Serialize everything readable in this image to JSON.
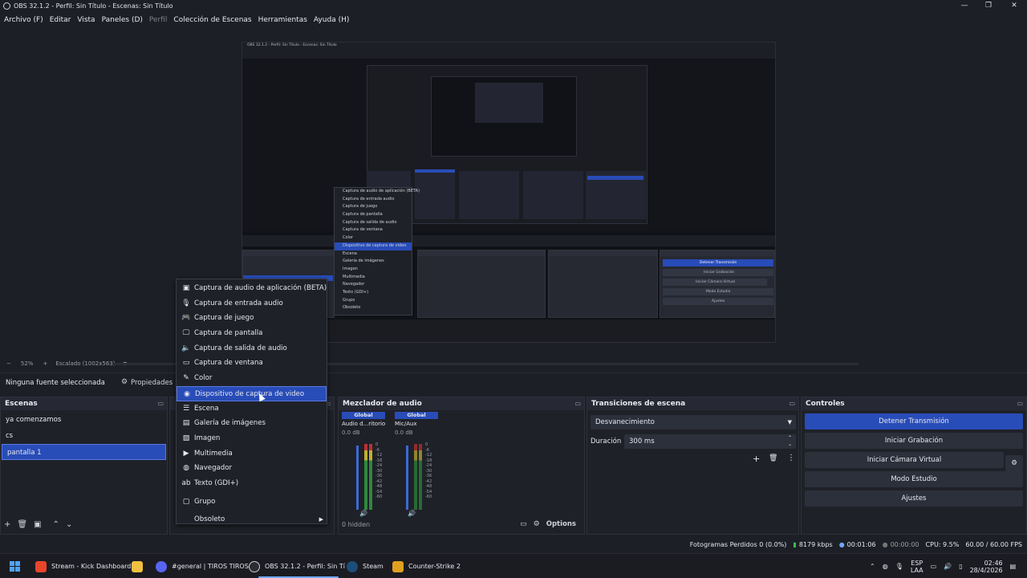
{
  "window": {
    "title": "OBS 32.1.2 - Perfil: Sin Título - Escenas: Sin Título",
    "minimize": "—",
    "maximize": "❐",
    "close": "✕"
  },
  "menubar": [
    "Archivo (F)",
    "Editar",
    "Vista",
    "Paneles (D)",
    "Perfil",
    "Colección de Escenas",
    "Herramientas",
    "Ayuda (H)"
  ],
  "zoombar": {
    "minus": "−",
    "zoom": "52%",
    "plus": "+",
    "scale": "Escalado (1002x563)"
  },
  "sourcebar": {
    "no_source": "Ninguna fuente seleccionada",
    "properties": "Propiedades"
  },
  "scenes": {
    "title": "Escenas",
    "items": [
      "ya comenzamos",
      "cs",
      "pantalla 1"
    ],
    "active_index": 2
  },
  "context_menu": {
    "items": [
      {
        "label": "Captura de audio de aplicación (BETA)",
        "icon": "app-audio-icon"
      },
      {
        "label": "Captura de entrada audio",
        "icon": "microphone-icon"
      },
      {
        "label": "Captura de juego",
        "icon": "gamepad-icon"
      },
      {
        "label": "Captura de pantalla",
        "icon": "monitor-icon"
      },
      {
        "label": "Captura de salida de audio",
        "icon": "speaker-icon"
      },
      {
        "label": "Captura de ventana",
        "icon": "window-icon"
      },
      {
        "label": "Color",
        "icon": "brush-icon"
      },
      {
        "label": "Dispositivo de captura de video",
        "icon": "camera-icon"
      },
      {
        "label": "Escena",
        "icon": "list-icon"
      },
      {
        "label": "Galería de imágenes",
        "icon": "gallery-icon"
      },
      {
        "label": "Imagen",
        "icon": "image-icon"
      },
      {
        "label": "Multimedia",
        "icon": "play-icon"
      },
      {
        "label": "Navegador",
        "icon": "globe-icon"
      },
      {
        "label": "Texto (GDI+)",
        "icon": "text-icon"
      }
    ],
    "selected_index": 7,
    "group": "Grupo",
    "obsolete": "Obsoleto"
  },
  "mixer": {
    "title": "Mezclador de audio",
    "channels": [
      {
        "tag": "Global",
        "name": "Audio d...ritorio",
        "db": "0.0 dB"
      },
      {
        "tag": "Global",
        "name": "Mic/Aux",
        "db": "0.0 dB"
      }
    ],
    "scale": [
      "0",
      "-6",
      "-12",
      "-18",
      "-24",
      "-30",
      "-36",
      "-42",
      "-48",
      "-54",
      "-60"
    ],
    "hidden": "0 hidden",
    "options": "Options"
  },
  "transitions": {
    "title": "Transiciones de escena",
    "transition": "Desvanecimiento",
    "duration_label": "Duración",
    "duration_value": "300 ms"
  },
  "controls": {
    "title": "Controles",
    "stop_stream": "Detener Transmisión",
    "start_recording": "Iniciar Grabación",
    "virtual_cam": "Iniciar Cámara Virtual",
    "studio_mode": "Modo Estudio",
    "settings": "Ajustes"
  },
  "status": {
    "dropped": "Fotogramas Perdidos 0 (0.0%)",
    "bitrate": "8179 kbps",
    "stream_time": "00:01:06",
    "rec_time": "00:00:00",
    "cpu": "CPU: 9.5%",
    "fps": "60.00 / 60.00 FPS"
  },
  "taskbar": {
    "apps": [
      {
        "label": "Stream - Kick Dashboard",
        "color": "#e8452b"
      },
      {
        "label": "",
        "color": "#f0c040"
      },
      {
        "label": "#general | TIROS TIROS",
        "color": "#5865f2"
      },
      {
        "label": "OBS 32.1.2 - Perfil: Sin Tí",
        "color": "#2b2d33"
      },
      {
        "label": "Steam",
        "color": "#1b4e7a"
      },
      {
        "label": "Counter-Strike 2",
        "color": "#e0a020"
      }
    ],
    "lang": "ESP",
    "lang2": "LAA",
    "time": "02:46",
    "date": "28/4/2026"
  },
  "preview_nested": {
    "title": "OBS 32.1.2 - Perfil: Sin Título - Escenas: Sin Título",
    "menu_items": [
      "Captura de audio de aplicación (BETA)",
      "Captura de entrada audio",
      "Captura de juego",
      "Captura de pantalla",
      "Captura de salida de audio",
      "Captura de ventana",
      "Color",
      "Dispositivo de captura de video",
      "Escena",
      "Galería de imágenes",
      "Imagen",
      "Multimedia",
      "Navegador",
      "Texto (GDI+)",
      "Grupo",
      "Obsoleto"
    ],
    "stop_stream": "Detener Transmisión",
    "start_rec": "Iniciar Grabación",
    "virtual_cam": "Iniciar Cámara Virtual",
    "studio": "Modo Estudio",
    "settings": "Ajustes"
  }
}
